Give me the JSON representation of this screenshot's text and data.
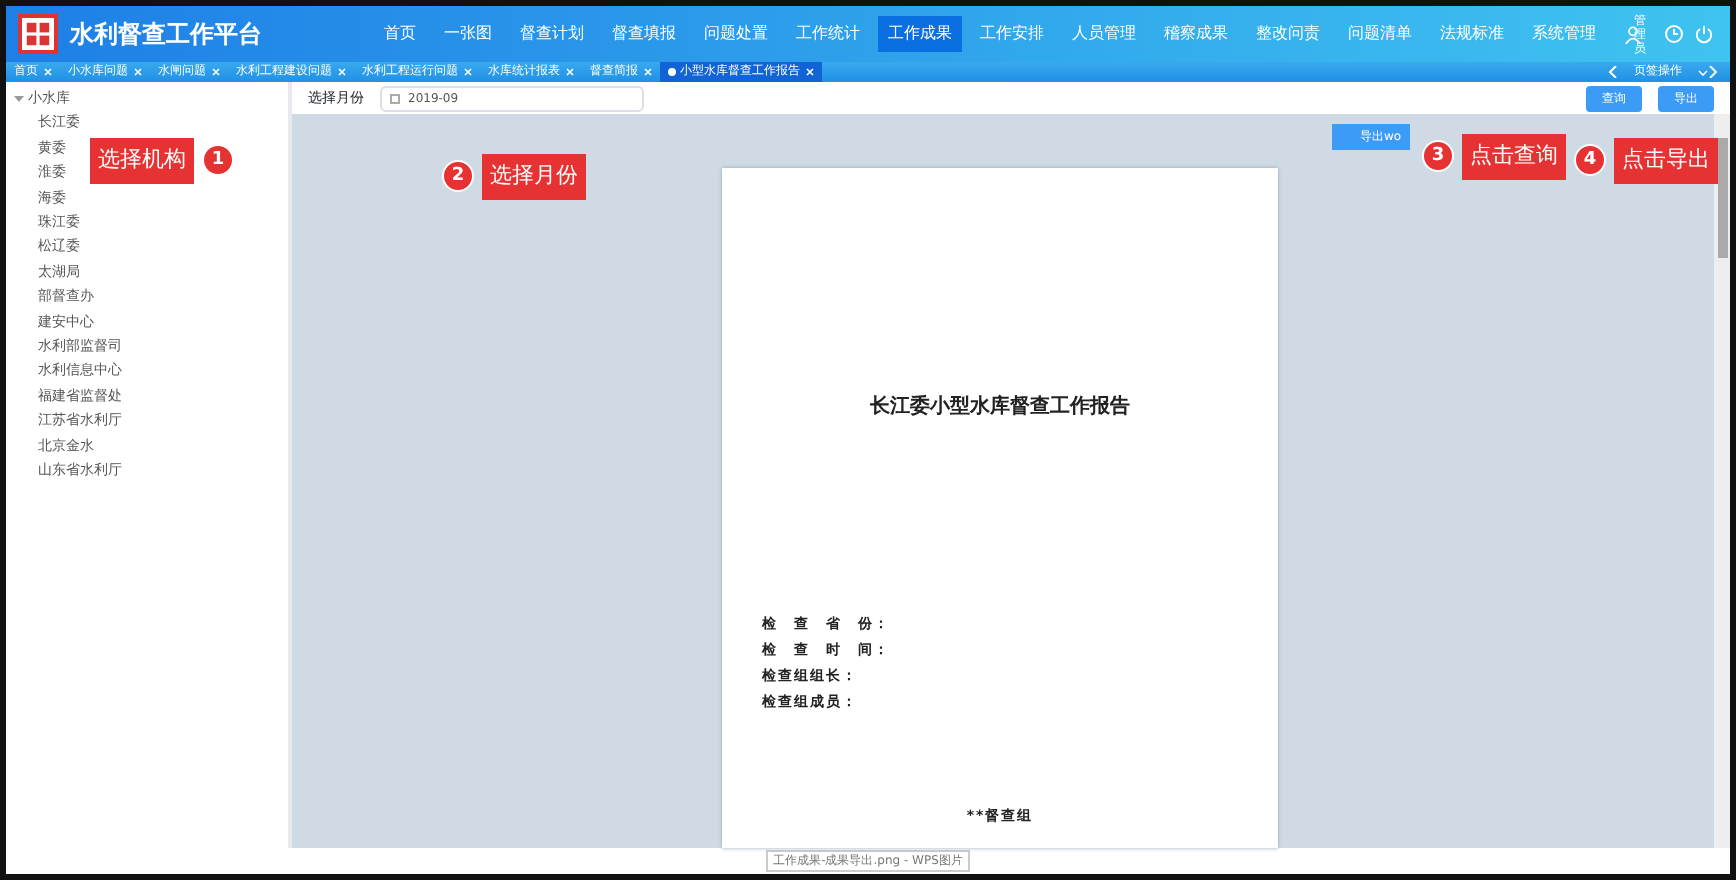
{
  "app": {
    "title": "水利督查工作平台",
    "user": "管理员"
  },
  "nav": [
    {
      "label": "首页",
      "selected": false
    },
    {
      "label": "一张图",
      "selected": false
    },
    {
      "label": "督查计划",
      "selected": false
    },
    {
      "label": "督查填报",
      "selected": false
    },
    {
      "label": "问题处置",
      "selected": false
    },
    {
      "label": "工作统计",
      "selected": false
    },
    {
      "label": "工作成果",
      "selected": true
    },
    {
      "label": "工作安排",
      "selected": false
    },
    {
      "label": "人员管理",
      "selected": false
    },
    {
      "label": "稽察成果",
      "selected": false
    },
    {
      "label": "整改问责",
      "selected": false
    },
    {
      "label": "问题清单",
      "selected": false
    },
    {
      "label": "法规标准",
      "selected": false
    },
    {
      "label": "系统管理",
      "selected": false
    }
  ],
  "tabs": [
    {
      "label": "首页",
      "selected": false
    },
    {
      "label": "小水库问题",
      "selected": false
    },
    {
      "label": "水闸问题",
      "selected": false
    },
    {
      "label": "水利工程建设问题",
      "selected": false
    },
    {
      "label": "水利工程运行问题",
      "selected": false
    },
    {
      "label": "水库统计报表",
      "selected": false
    },
    {
      "label": "督查简报",
      "selected": false
    },
    {
      "label": "小型水库督查工作报告",
      "selected": true
    }
  ],
  "tab_actions": "页签操作",
  "tree": {
    "label": "小水库",
    "expanded": true,
    "children": [
      {
        "label": "长江委"
      },
      {
        "label": "黄委"
      },
      {
        "label": "淮委"
      },
      {
        "label": "海委"
      },
      {
        "label": "珠江委"
      },
      {
        "label": "松辽委"
      },
      {
        "label": "太湖局"
      },
      {
        "label": "部督查办"
      },
      {
        "label": "建安中心"
      },
      {
        "label": "水利部监督司"
      },
      {
        "label": "水利信息中心"
      },
      {
        "label": "福建省监督处"
      },
      {
        "label": "江苏省水利厅"
      },
      {
        "label": "北京金水"
      },
      {
        "label": "山东省水利厅"
      }
    ]
  },
  "toolbar": {
    "month_label": "选择月份",
    "month_value": "2019-09",
    "buttons": [
      "查询",
      "导出"
    ],
    "export_word": "导出wo"
  },
  "document": {
    "title": "长江委小型水库督查工作报告",
    "fields": [
      "检　查　省　份：",
      "检　查　时　间：",
      "检查组组长：",
      "检查组成员："
    ],
    "footer": "**督查组"
  },
  "annotations": [
    {
      "number": "1",
      "label": "选择机构"
    },
    {
      "number": "2",
      "label": "选择月份"
    },
    {
      "number": "3",
      "label": "点击查询"
    },
    {
      "number": "4",
      "label": "点击导出"
    }
  ],
  "taskbar_tip": "工作成果-成果导出.png - WPS图片"
}
